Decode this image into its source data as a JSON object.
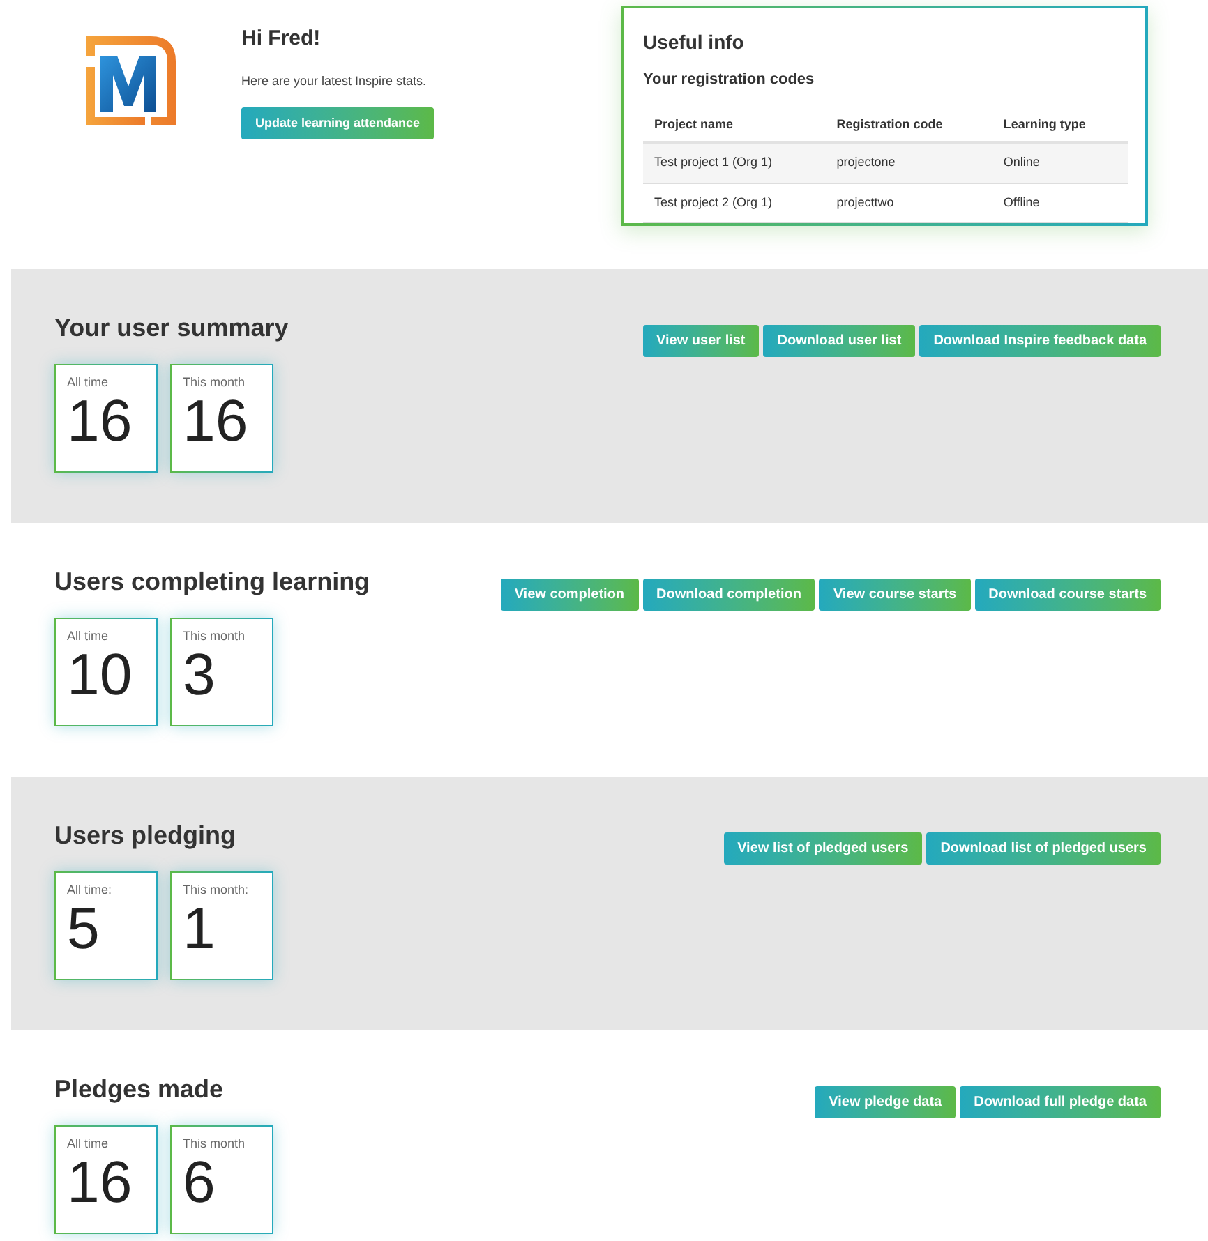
{
  "greeting": {
    "title": "Hi Fred!",
    "subtitle": "Here are your latest Inspire stats.",
    "button": "Update learning attendance"
  },
  "useful_info": {
    "title": "Useful info",
    "subtitle": "Your registration codes",
    "table": {
      "columns": [
        "Project name",
        "Registration code",
        "Learning type"
      ],
      "rows": [
        [
          "Test project 1 (Org 1)",
          "projectone",
          "Online"
        ],
        [
          "Test project 2 (Org 1)",
          "projecttwo",
          "Offline"
        ]
      ]
    }
  },
  "sections": [
    {
      "title": "Your user summary",
      "shaded": true,
      "buttons": [
        "View user list",
        "Download user list",
        "Download Inspire feedback data"
      ],
      "stats": [
        {
          "label": "All time",
          "value": "16"
        },
        {
          "label": "This month",
          "value": "16"
        }
      ]
    },
    {
      "title": "Users completing learning",
      "shaded": false,
      "buttons": [
        "View completion",
        "Download completion",
        "View course starts",
        "Download course starts"
      ],
      "stats": [
        {
          "label": "All time",
          "value": "10"
        },
        {
          "label": "This month",
          "value": "3"
        }
      ]
    },
    {
      "title": "Users pledging",
      "shaded": true,
      "buttons": [
        "View list of pledged users",
        "Download list of pledged users"
      ],
      "stats": [
        {
          "label": "All time:",
          "value": "5"
        },
        {
          "label": "This month:",
          "value": "1"
        }
      ]
    },
    {
      "title": "Pledges made",
      "shaded": false,
      "buttons": [
        "View pledge data",
        "Download full pledge data"
      ],
      "stats": [
        {
          "label": "All time",
          "value": "16"
        },
        {
          "label": "This month",
          "value": "6"
        }
      ]
    }
  ]
}
